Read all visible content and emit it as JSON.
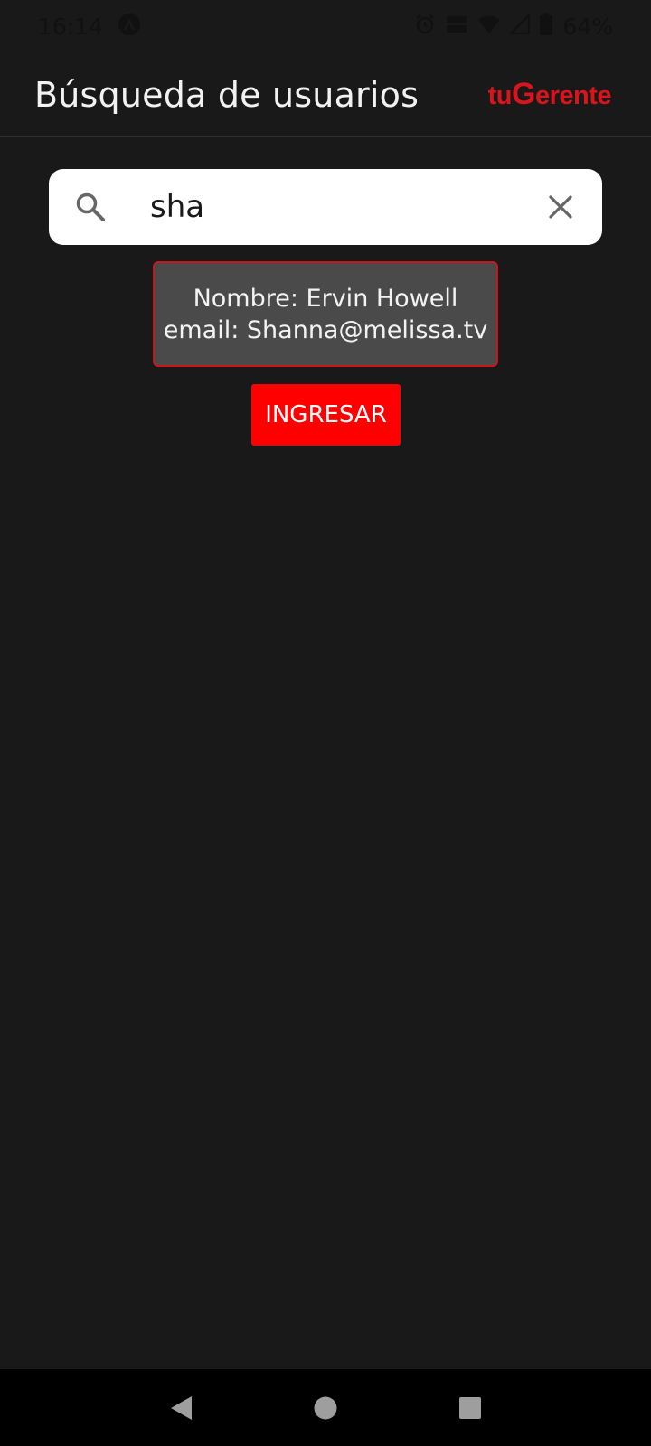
{
  "status_bar": {
    "time": "16:14",
    "battery": "64%",
    "network_label": "VoLTE"
  },
  "header": {
    "title": "Búsqueda de usuarios",
    "brand_prefix": "tu",
    "brand_letter": "G",
    "brand_suffix": "erente",
    "brand_color": "#d8141c"
  },
  "search": {
    "value": "sha",
    "search_icon": "search-icon",
    "clear_icon": "close-icon"
  },
  "result": {
    "name_line": "Nombre: Ervin Howell",
    "email_line": "email: Shanna@melissa.tv",
    "border_color": "#c8161d"
  },
  "actions": {
    "ingresar_label": "INGRESAR",
    "button_color": "#ff0000"
  },
  "nav": {
    "back_icon": "back-triangle-icon",
    "home_icon": "home-circle-icon",
    "recents_icon": "recents-square-icon"
  }
}
